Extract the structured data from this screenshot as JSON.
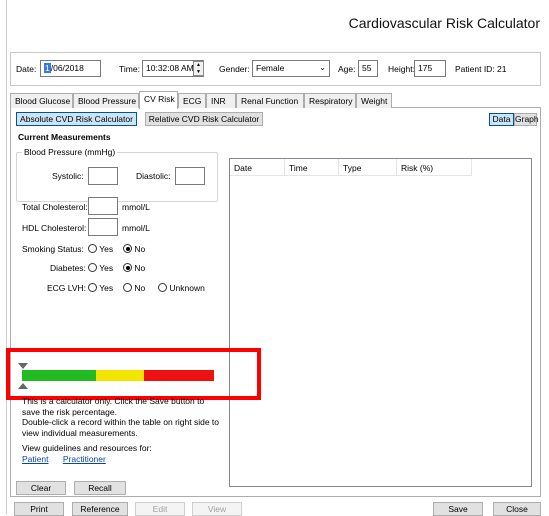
{
  "app": {
    "title": "Cardiovascular Risk Calculator"
  },
  "patient_bar": {
    "date_label": "Date:",
    "date_day": "1",
    "date_rest": "/06/2018",
    "time_label": "Time:",
    "time_value": "10:32:08 AM",
    "gender_label": "Gender:",
    "gender_value": "Female",
    "age_label": "Age:",
    "age_value": "55",
    "height_label": "Height:",
    "height_value": "175",
    "patient_id_label": "Patient ID: 21"
  },
  "tabs": [
    "Blood Glucose",
    "Blood Pressure",
    "CV Risk",
    "ECG",
    "INR",
    "Renal Function",
    "Respiratory",
    "Weight"
  ],
  "subtabs": {
    "absolute": "Absolute CVD Risk Calculator",
    "relative": "Relative CVD Risk Calculator"
  },
  "view_buttons": {
    "data": "Data",
    "graph": "Graph"
  },
  "current": {
    "heading": "Current Measurements",
    "bp_group": "Blood Pressure (mmHg)",
    "systolic_label": "Systolic:",
    "diastolic_label": "Diastolic:",
    "total_chol_label": "Total Cholesterol:",
    "hdl_label": "HDL Cholesterol:",
    "unit": "mmol/L",
    "smoking_label": "Smoking Status:",
    "diabetes_label": "Diabetes:",
    "ecg_label": "ECG LVH:",
    "yes": "Yes",
    "no": "No",
    "unknown": "Unknown",
    "smoking_value": "No",
    "diabetes_value": "No"
  },
  "grid": {
    "columns": [
      "Date",
      "Time",
      "Type",
      "Risk (%)"
    ],
    "rows": []
  },
  "risk_scale": {
    "colors": {
      "low": "#22bb22",
      "moderate": "#f2e600",
      "high": "#ee1111",
      "highlight": "#ff0000"
    },
    "level": 0
  },
  "note": {
    "line1": "This is a calculator only. Click the Save button to",
    "line2": "save the risk percentage.",
    "line3": "Double-click a record within the table on right side to",
    "line4": "view individual measurements.",
    "line5": "View guidelines and resources for:",
    "patient_link": "Patient",
    "practitioner_link": "Practitioner"
  },
  "panel_buttons": {
    "clear": "Clear",
    "recall": "Recall"
  },
  "footer": {
    "print": "Print",
    "reference": "Reference",
    "edit": "Edit",
    "view": "View",
    "save": "Save",
    "close": "Close"
  }
}
